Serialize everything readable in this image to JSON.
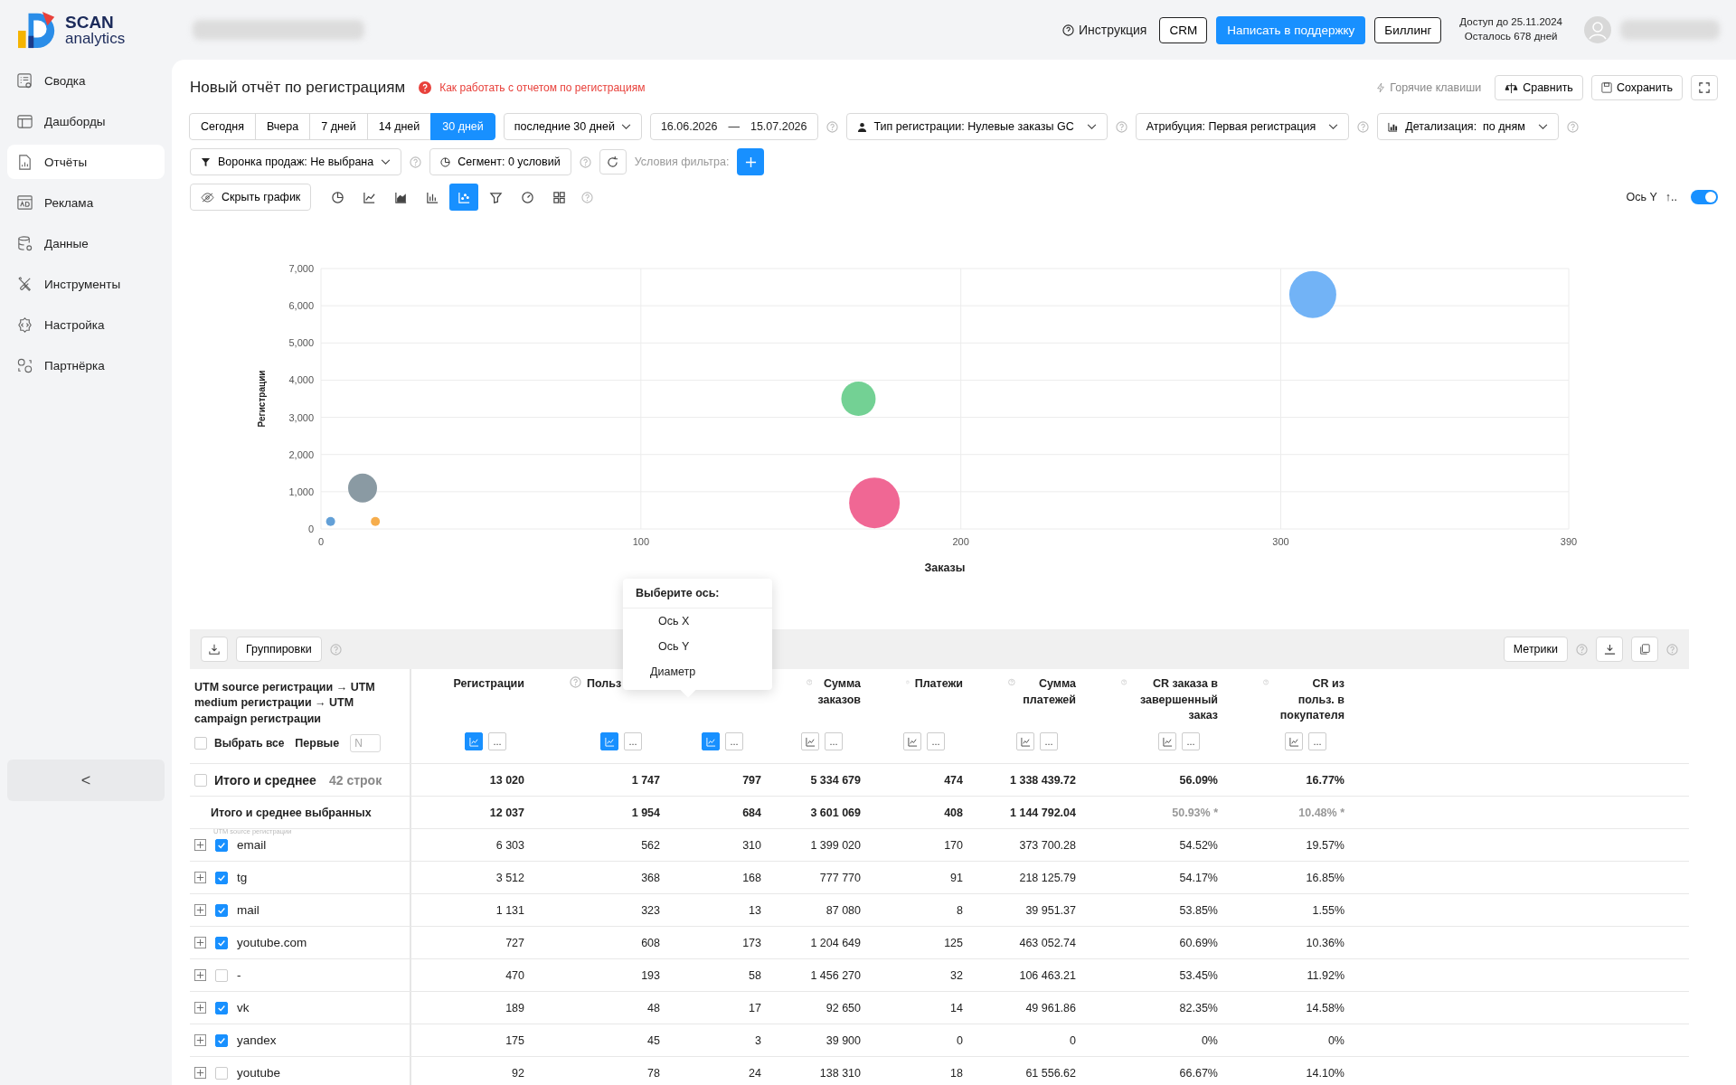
{
  "logo": {
    "word": "SCAN",
    "sub": "analytics"
  },
  "topbar": {
    "help_link": "Инструкция",
    "crm": "CRM",
    "support": "Написать в поддержку",
    "billing": "Биллинг",
    "access": "Доступ до 25.11.2024",
    "remaining": "Осталось 678 дней"
  },
  "sidebar": {
    "items": [
      {
        "label": "Сводка",
        "selected": false
      },
      {
        "label": "Дашборды",
        "selected": false
      },
      {
        "label": "Отчёты",
        "selected": true
      },
      {
        "label": "Реклама",
        "selected": false
      },
      {
        "label": "Данные",
        "selected": false
      },
      {
        "label": "Инструменты",
        "selected": false
      },
      {
        "label": "Настройка",
        "selected": false
      },
      {
        "label": "Партнёрка",
        "selected": false
      }
    ],
    "collapse": "<"
  },
  "report": {
    "title": "Новый отчёт по регистрациям",
    "help_link": "Как работать с отчетом по регистрациям",
    "hotkeys": "Горячие клавиши",
    "compare": "Сравнить",
    "save": "Сохранить"
  },
  "periods": [
    {
      "label": "Сегодня",
      "selected": false
    },
    {
      "label": "Вчера",
      "selected": false
    },
    {
      "label": "7 дней",
      "selected": false
    },
    {
      "label": "14 дней",
      "selected": false
    },
    {
      "label": "30 дней",
      "selected": true
    }
  ],
  "period_dropdown": "последние 30 дней",
  "date_range": {
    "from": "16.06.2026",
    "separator": "—",
    "to": "15.07.2026"
  },
  "filters": [
    {
      "label": "Тип регистрации: Нулевые заказы GC"
    },
    {
      "label": "Атрибуция: Первая регистрация"
    },
    {
      "label": "Детализация:  по дням"
    }
  ],
  "funnel": "Воронка продаж: Не выбрана",
  "segment": "Сегмент: 0 условий",
  "filter_conditions": "Условия фильтра:",
  "hide_chart": "Скрыть график",
  "chart_types": [
    {
      "selected": false
    },
    {
      "selected": false
    },
    {
      "selected": false
    },
    {
      "selected": false
    },
    {
      "selected": true
    },
    {
      "selected": false
    },
    {
      "selected": false
    },
    {
      "selected": false
    }
  ],
  "axis_toggle": {
    "label": "Ось Y",
    "suffix": "↑..",
    "on": true
  },
  "chart_data": {
    "type": "scatter",
    "xlabel": "Заказы",
    "ylabel": "Регистрации",
    "xlim": [
      0,
      390
    ],
    "ylim": [
      0,
      7000
    ],
    "grid": true,
    "xticks": [
      0,
      100,
      200,
      300,
      390
    ],
    "yticks": [
      {
        "value": 0,
        "label": "0"
      },
      {
        "value": 1000,
        "label": "1,000"
      },
      {
        "value": 2000,
        "label": "2,000"
      },
      {
        "value": 3000,
        "label": "3,000"
      },
      {
        "value": 4000,
        "label": "4,000"
      },
      {
        "value": 5000,
        "label": "5,000"
      },
      {
        "value": 6000,
        "label": "6,000"
      },
      {
        "value": 7000,
        "label": "7,000"
      }
    ],
    "series": [
      {
        "color": "#6aaff5",
        "x": [
          310
        ],
        "values": [
          6300
        ]
      },
      {
        "color": "#6ccf8e",
        "x": [
          168
        ],
        "values": [
          3500
        ]
      },
      {
        "color": "#84959e",
        "x": [
          13
        ],
        "values": [
          1100
        ]
      },
      {
        "color": "#ef5f8e",
        "x": [
          173
        ],
        "values": [
          700
        ]
      },
      {
        "color": "#f5a942",
        "x": [
          17
        ],
        "values": [
          200
        ]
      },
      {
        "color": "#5b9bd5",
        "x": [
          3
        ],
        "values": [
          200
        ]
      }
    ]
  },
  "axis_menu": {
    "title": "Выберите ось:",
    "options": [
      "Ось X",
      "Ось Y",
      "Диаметр"
    ]
  },
  "table_toolbar": {
    "groupings": "Группировки",
    "metrics": "Метрики"
  },
  "table": {
    "group_header": "UTM source регистрации → UTM medium регистрации → UTM campaign регистрации",
    "select_all": {
      "label": "Выбрать все",
      "checked": false
    },
    "first_label": "Первые",
    "first_placeholder": "N",
    "columns": [
      {
        "label": "Регистрации",
        "chart_on": true,
        "menu": "..."
      },
      {
        "label": "Польз",
        "chart_on": true,
        "menu": "..."
      },
      {
        "chart_on": true,
        "menu": "..."
      },
      {
        "label": "Сумма заказов",
        "chart_on": false,
        "menu": "..."
      },
      {
        "label": "Платежи",
        "chart_on": false,
        "menu": "..."
      },
      {
        "label": "Сумма платежей",
        "chart_on": false,
        "menu": "..."
      },
      {
        "label": "CR заказа в завершенный заказ",
        "chart_on": false,
        "menu": "..."
      },
      {
        "label": "CR из польз. в покупателя",
        "chart_on": false,
        "menu": "..."
      }
    ],
    "total": {
      "label": "Итого и среднее",
      "count": "42 строк",
      "checked": false,
      "values": [
        "13 020",
        "1 747",
        "797",
        "5 334 679",
        "474",
        "1 338 439.72",
        "56.09%",
        "16.77%"
      ]
    },
    "selected_total": {
      "label": "Итого и среднее выбранных",
      "values": [
        {
          "text": "12 037",
          "muted": false
        },
        {
          "text": "1 954",
          "muted": false
        },
        {
          "text": "684",
          "muted": false
        },
        {
          "text": "3 601 069",
          "muted": false
        },
        {
          "text": "408",
          "muted": false
        },
        {
          "text": "1 144 792.04",
          "muted": false
        },
        {
          "text": "50.93% *",
          "muted": true
        },
        {
          "text": "10.48% *",
          "muted": true
        }
      ]
    },
    "level_hint": "UTM source регистрации",
    "rows": [
      {
        "name": "email",
        "checked": true,
        "values": [
          "6 303",
          "562",
          "310",
          "1 399 020",
          "170",
          "373 700.28",
          "54.52%",
          "19.57%"
        ]
      },
      {
        "name": "tg",
        "checked": true,
        "values": [
          "3 512",
          "368",
          "168",
          "777 770",
          "91",
          "218 125.79",
          "54.17%",
          "16.85%"
        ]
      },
      {
        "name": "mail",
        "checked": true,
        "values": [
          "1 131",
          "323",
          "13",
          "87 080",
          "8",
          "39 951.37",
          "53.85%",
          "1.55%"
        ]
      },
      {
        "name": "youtube.com",
        "checked": true,
        "values": [
          "727",
          "608",
          "173",
          "1 204 649",
          "125",
          "463 052.74",
          "60.69%",
          "10.36%"
        ]
      },
      {
        "name": "-",
        "checked": false,
        "values": [
          "470",
          "193",
          "58",
          "1 456 270",
          "32",
          "106 463.21",
          "53.45%",
          "11.92%"
        ]
      },
      {
        "name": "vk",
        "checked": true,
        "values": [
          "189",
          "48",
          "17",
          "92 650",
          "14",
          "49 961.86",
          "82.35%",
          "14.58%"
        ]
      },
      {
        "name": "yandex",
        "checked": true,
        "values": [
          "175",
          "45",
          "3",
          "39 900",
          "0",
          "0",
          "0%",
          "0%"
        ]
      },
      {
        "name": "youtube",
        "checked": false,
        "values": [
          "92",
          "78",
          "24",
          "138 310",
          "18",
          "61 556.62",
          "66.67%",
          "14.10%"
        ]
      }
    ]
  }
}
